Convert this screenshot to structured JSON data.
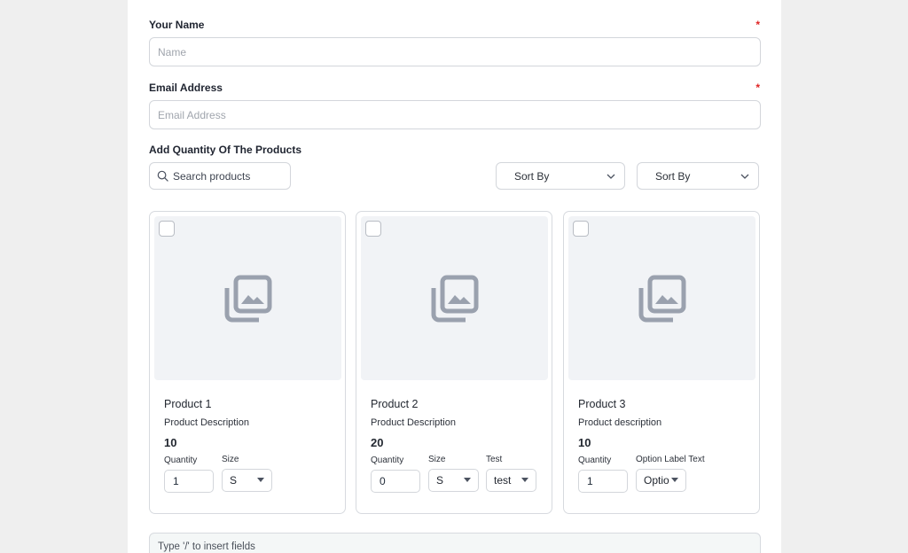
{
  "form": {
    "name": {
      "label": "Your Name",
      "required_mark": "*",
      "placeholder": "Name",
      "value": ""
    },
    "email": {
      "label": "Email Address",
      "required_mark": "*",
      "placeholder": "Email Address",
      "value": ""
    },
    "products": {
      "label": "Add Quantity Of The Products",
      "search_placeholder": "Search products",
      "sort_1": "Sort By",
      "sort_2": "Sort By",
      "items": [
        {
          "title": "Product 1",
          "description": "Product Description",
          "price": "10",
          "quantity_label": "Quantity",
          "quantity_value": "1",
          "options": [
            {
              "label": "Size",
              "value": "S"
            }
          ]
        },
        {
          "title": "Product 2",
          "description": "Product Description",
          "price": "20",
          "quantity_label": "Quantity",
          "quantity_value": "0",
          "options": [
            {
              "label": "Size",
              "value": "S"
            },
            {
              "label": "Test",
              "value": "test"
            }
          ]
        },
        {
          "title": "Product 3",
          "description": "Product description",
          "price": "10",
          "quantity_label": "Quantity",
          "quantity_value": "1",
          "options": [
            {
              "label": "Option Label Text",
              "value": "Optio"
            }
          ]
        }
      ]
    },
    "editor": {
      "placeholder": "Type '/' to insert fields"
    }
  },
  "colors": {
    "page_background": "#efefef",
    "panel_background": "#ffffff",
    "required_mark": "#e02424",
    "image_placeholder_bg": "#f1f3f6",
    "image_icon": "#9aa1ae"
  },
  "icons": {
    "search": "search-icon",
    "dropdown": "chevron-down-icon",
    "image_placeholder": "image-gallery-icon"
  }
}
